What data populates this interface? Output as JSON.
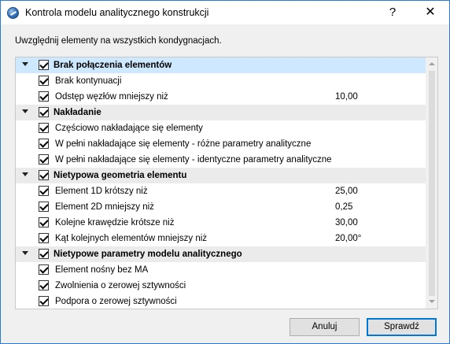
{
  "window": {
    "title": "Kontrola modelu analitycznego konstrukcji",
    "help_label": "?",
    "close_label": "✕"
  },
  "instruction": "Uwzględnij elementy na wszystkich kondygnacjach.",
  "groups": [
    {
      "label": "Brak połączenia elementów",
      "checked": true,
      "expanded": true,
      "selected": true,
      "items": [
        {
          "label": "Brak kontynuacji",
          "checked": true,
          "value": ""
        },
        {
          "label": "Odstęp węzłów mniejszy niż",
          "checked": true,
          "value": "10,00"
        }
      ]
    },
    {
      "label": "Nakładanie",
      "checked": true,
      "expanded": true,
      "selected": false,
      "items": [
        {
          "label": "Częściowo nakładające się elementy",
          "checked": true,
          "value": ""
        },
        {
          "label": "W pełni nakładające się elementy - różne parametry analityczne",
          "checked": true,
          "value": ""
        },
        {
          "label": "W pełni nakładające się elementy - identyczne parametry analityczne",
          "checked": true,
          "value": ""
        }
      ]
    },
    {
      "label": "Nietypowa geometria elementu",
      "checked": true,
      "expanded": true,
      "selected": false,
      "items": [
        {
          "label": "Element 1D krótszy niż",
          "checked": true,
          "value": "25,00"
        },
        {
          "label": "Element 2D mniejszy niż",
          "checked": true,
          "value": "0,25"
        },
        {
          "label": "Kolejne krawędzie krótsze niż",
          "checked": true,
          "value": "30,00"
        },
        {
          "label": "Kąt kolejnych elementów mniejszy niż",
          "checked": true,
          "value": "20,00°"
        }
      ]
    },
    {
      "label": "Nietypowe parametry modelu analitycznego",
      "checked": true,
      "expanded": true,
      "selected": false,
      "items": [
        {
          "label": "Element nośny bez MA",
          "checked": true,
          "value": ""
        },
        {
          "label": "Zwolnienia o zerowej sztywności",
          "checked": true,
          "value": ""
        },
        {
          "label": "Podpora o zerowej sztywności",
          "checked": true,
          "value": ""
        }
      ]
    }
  ],
  "buttons": {
    "cancel": "Anuluj",
    "check": "Sprawdź"
  },
  "colors": {
    "selected_row": "#cde8ff",
    "group_row": "#ebebeb",
    "window_border": "#2b79d8",
    "primary_button_border": "#0078d7"
  }
}
